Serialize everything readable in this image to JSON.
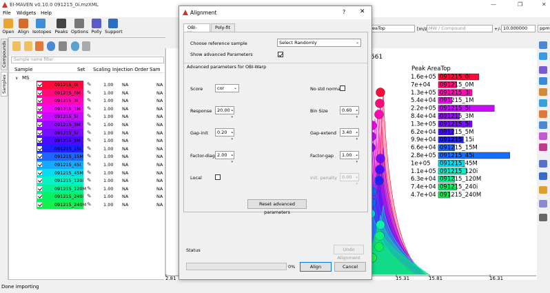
{
  "window": {
    "title": "EI-MAVEN v0.10.0 091215_0i.mzXML"
  },
  "menu": [
    "File",
    "Widgets",
    "Help"
  ],
  "toolbar": [
    {
      "label": "Open",
      "icon": "folder-open-icon",
      "color": "#e8a530"
    },
    {
      "label": "Align",
      "icon": "align-icon",
      "color": "#d86b2a"
    },
    {
      "label": "Isotopes",
      "icon": "isotopes-icon",
      "color": "#3c8fd8"
    },
    {
      "label": "Peaks",
      "icon": "peaks-icon",
      "color": "#444444"
    },
    {
      "label": "Options",
      "icon": "wrench-icon",
      "color": "#777777"
    },
    {
      "label": "Polly",
      "icon": "polly-icon",
      "color": "#5a5ac8"
    },
    {
      "label": "Support",
      "icon": "support-icon",
      "color": "#2a6fc0"
    }
  ],
  "side_tabs": {
    "compounds": "Compounds",
    "samples": "Samples"
  },
  "samples": {
    "filter_placeholder": "Sample name filter",
    "headers": {
      "sample": "Sample",
      "set": "Set",
      "scaling": "Scaling",
      "injection": "Injection Order",
      "sam": "Sam"
    },
    "group": "MS",
    "rows": [
      {
        "name": "091215_0i",
        "color": "#ff0a3c",
        "scaling": "1.00",
        "injection": "NA",
        "sam": "NA"
      },
      {
        "name": "091215_0M",
        "color": "#ff0a78",
        "scaling": "1.00",
        "injection": "NA",
        "sam": "NA"
      },
      {
        "name": "091215_3i",
        "color": "#ff0ab4",
        "scaling": "1.00",
        "injection": "NA",
        "sam": "NA"
      },
      {
        "name": "091215_1M",
        "color": "#f00af0",
        "scaling": "1.00",
        "injection": "NA",
        "sam": "NA"
      },
      {
        "name": "091215_5i",
        "color": "#c80aff",
        "scaling": "1.00",
        "injection": "NA",
        "sam": "NA"
      },
      {
        "name": "091215_3M",
        "color": "#960aff",
        "scaling": "1.00",
        "injection": "NA",
        "sam": "NA"
      },
      {
        "name": "091215_5i",
        "color": "#780aff",
        "scaling": "1.00",
        "injection": "NA",
        "sam": "NA"
      },
      {
        "name": "091215_5M",
        "color": "#4b0aff",
        "scaling": "1.00",
        "injection": "NA",
        "sam": "NA"
      },
      {
        "name": "091215_15i",
        "color": "#1e1eff",
        "scaling": "1.00",
        "injection": "NA",
        "sam": "NA"
      },
      {
        "name": "091215_15M",
        "color": "#1e64ff",
        "scaling": "1.00",
        "injection": "NA",
        "sam": "NA"
      },
      {
        "name": "091215_45i",
        "color": "#14aaff",
        "scaling": "1.00",
        "injection": "NA",
        "sam": "NA"
      },
      {
        "name": "091215_45M",
        "color": "#0adcf0",
        "scaling": "1.00",
        "injection": "NA",
        "sam": "NA"
      },
      {
        "name": "091215_120i",
        "color": "#0af0c8",
        "scaling": "1.00",
        "injection": "NA",
        "sam": "NA"
      },
      {
        "name": "091215_120M",
        "color": "#0af096",
        "scaling": "1.00",
        "injection": "NA",
        "sam": "NA"
      },
      {
        "name": "091215_240i",
        "color": "#0af064",
        "scaling": "1.00",
        "injection": "NA",
        "sam": "NA"
      },
      {
        "name": "091215_240M",
        "color": "#14f050",
        "scaling": "1.00",
        "injection": "NA",
        "sam": "NA"
      }
    ]
  },
  "status": "Done importing",
  "top_right": {
    "quant": "AreaTop",
    "unit": "[m/z]",
    "compound_placeholder": "MW / Compound",
    "pm": "+/-",
    "tolerance": "10.000000",
    "tol_unit": "ppm"
  },
  "plot": {
    "title_fragment": "561",
    "legend_title": "Peak AreaTop",
    "legend": [
      {
        "value": "1.6e+05",
        "name": "091215_0i",
        "color": "#ff0a3c",
        "frac": 0.42
      },
      {
        "value": "7e+04",
        "name": "091215_0M",
        "color": "#ff0a78",
        "frac": 0.19
      },
      {
        "value": "1.3e+05",
        "name": "091215_3i",
        "color": "#ff0ab4",
        "frac": 0.35
      },
      {
        "value": "5.4e+04",
        "name": "091215_1M",
        "color": "#f00af0",
        "frac": 0.14
      },
      {
        "value": "2.2e+05",
        "name": "091215_5i",
        "color": "#c80aff",
        "frac": 0.58
      },
      {
        "value": "8.4e+04",
        "name": "091215_3M",
        "color": "#960aff",
        "frac": 0.22
      },
      {
        "value": "1.3e+05",
        "name": "091215_5i",
        "color": "#780aff",
        "frac": 0.35
      },
      {
        "value": "6.2e+04",
        "name": "091215_5M",
        "color": "#4b0aff",
        "frac": 0.16
      },
      {
        "value": "9.9e+04",
        "name": "091215_15i",
        "color": "#1e1eff",
        "frac": 0.26
      },
      {
        "value": "6.6e+04",
        "name": "091215_15M",
        "color": "#1e64ff",
        "frac": 0.17
      },
      {
        "value": "2.8e+05",
        "name": "091215_45i",
        "color": "#146eff",
        "frac": 0.74
      },
      {
        "value": "1e+05",
        "name": "091215_45M",
        "color": "#0adcf0",
        "frac": 0.27
      },
      {
        "value": "1.1e+05",
        "name": "091215_120i",
        "color": "#0af0c8",
        "frac": 0.29
      },
      {
        "value": "6.3e+04",
        "name": "091215_120M",
        "color": "#0af096",
        "frac": 0.17
      },
      {
        "value": "7.4e+04",
        "name": "091215_240i",
        "color": "#0af064",
        "frac": 0.19
      },
      {
        "value": "4.7e+04",
        "name": "091215_240M",
        "color": "#14f050",
        "frac": 0.12
      }
    ],
    "x_ticks": [
      "2.81",
      "15.31",
      "15.81",
      "16.31"
    ]
  },
  "dialog": {
    "title": "Alignment",
    "help": "?",
    "tabs": [
      "OBI-Warp",
      "Poly-fit"
    ],
    "ref_label": "Choose reference sample",
    "ref_value": "Select Randomly",
    "show_adv_label": "Show advanced Parameters",
    "adv_title": "Advanced parameters for OBI-Warp",
    "score_label": "Score",
    "score_value": "cor",
    "nostd_label": "No std normal",
    "response_label": "Response",
    "response_value": "20.00",
    "binsize_label": "Bin Size",
    "binsize_value": "0.60",
    "gapinit_label": "Gap-init",
    "gapinit_value": "0.20",
    "gapext_label": "Gap-extend",
    "gapext_value": "3.40",
    "factordiag_label": "Factor-diag",
    "factordiag_value": "2.00",
    "factorgap_label": "Factor-gap",
    "factorgap_value": "1.00",
    "local_label": "Local",
    "initpen_label": "Init. penalty",
    "initpen_value": "0.00",
    "reset_label": "Reset advanced parameters",
    "status_label": "Status",
    "undo_label": "Undo Alignment",
    "progress": "0%",
    "align_label": "Align",
    "cancel_label": "Cancel"
  }
}
